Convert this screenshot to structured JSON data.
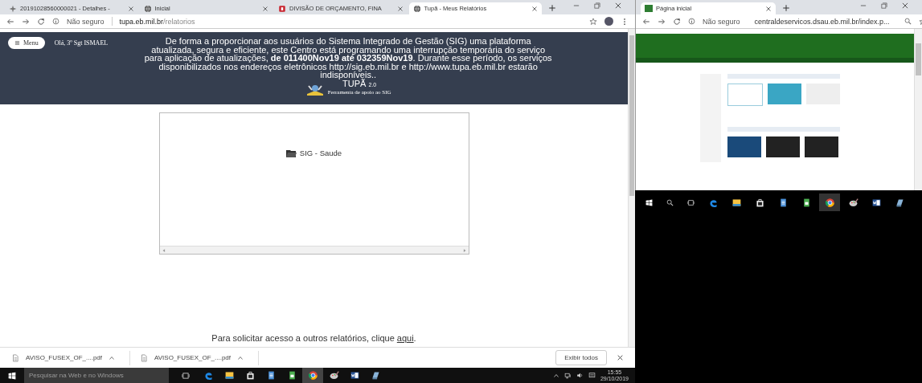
{
  "left_browser": {
    "tabs": [
      {
        "title": "20191028560000021 - Detalhes -",
        "selected": false
      },
      {
        "title": "Inicial",
        "selected": false
      },
      {
        "title": "DIVISÃO DE ORÇAMENTO, FINA",
        "selected": false
      },
      {
        "title": "Tupã - Meus Relatórios",
        "selected": true
      }
    ],
    "address": {
      "security": "Não seguro",
      "host": "tupa.eb.mil.br",
      "path": "/relatorios"
    },
    "header": {
      "menu_button": "Menu",
      "greeting": "Olá, 3º Sgt ISMAEL",
      "notice": "De forma a proporcionar aos usuários do Sistema Integrado de Gestão (SIG) uma plataforma atualizada, segura e eficiente, este Centro está programando uma interrupção temporária do serviço para aplicação de atualizações, **de 011400Nov19 até 032359Nov19**. Durante esse período, os serviços disponibilizados nos endereços eletrônicos http://sig.eb.mil.br e http://www.tupa.eb.mil.br estarão indisponíveis..",
      "logo_title": "TUPÃ",
      "logo_version": "2.0",
      "logo_subtitle": "Ferramenta de apoio ao SIG"
    },
    "report_list": {
      "items": [
        {
          "label": "SIG - Saude"
        }
      ]
    },
    "access_prompt": {
      "before": "Para solicitar acesso a outros relatórios, clique ",
      "link": "aqui",
      "after": "."
    },
    "downloads": [
      {
        "name": "AVISO_FUSEX_OF_....pdf"
      },
      {
        "name": "AVISO_FUSEX_OF_....pdf"
      }
    ],
    "show_all": "Exibir todos"
  },
  "right_browser": {
    "tabs": [
      {
        "title": "Página inicial",
        "selected": true
      }
    ],
    "address": {
      "security": "Não seguro",
      "url": "centraldeservicos.dsau.eb.mil.br/index.p..."
    }
  },
  "taskbar": {
    "search_placeholder": "Pesquisar na Web e no Windows",
    "apps": [
      {
        "kind": "edge",
        "active": false
      },
      {
        "kind": "explorer",
        "active": false
      },
      {
        "kind": "store",
        "active": false
      },
      {
        "kind": "document",
        "active": false
      },
      {
        "kind": "spreadsheet",
        "active": false
      },
      {
        "kind": "chrome",
        "active": true
      },
      {
        "kind": "paint",
        "active": false
      },
      {
        "kind": "word",
        "active": false
      },
      {
        "kind": "app",
        "active": false
      }
    ],
    "time": "15:55",
    "date": "29/10/2019"
  },
  "second_taskbar": {
    "apps": [
      {
        "kind": "edge",
        "active": false
      },
      {
        "kind": "explorer",
        "active": false
      },
      {
        "kind": "store",
        "active": false
      },
      {
        "kind": "document",
        "active": false
      },
      {
        "kind": "spreadsheet",
        "active": false
      },
      {
        "kind": "chrome",
        "active": true
      },
      {
        "kind": "paint",
        "active": false
      },
      {
        "kind": "word",
        "active": false
      },
      {
        "kind": "app",
        "active": false
      }
    ]
  }
}
